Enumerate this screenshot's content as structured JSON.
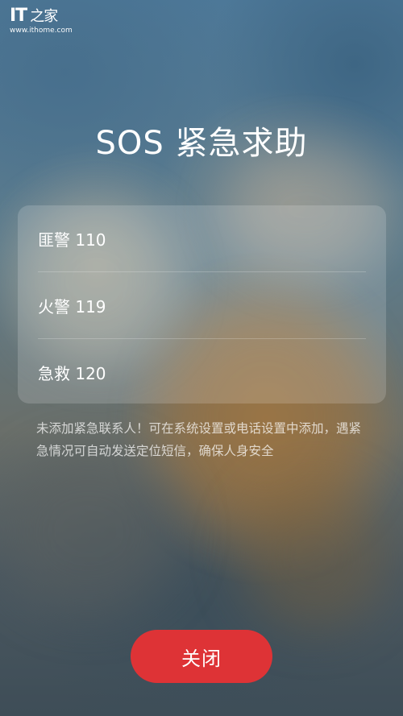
{
  "watermark": {
    "logo_latin": "IT",
    "logo_cjk": "之家",
    "url": "www.ithome.com"
  },
  "title": "SOS 紧急求助",
  "emergency_numbers": [
    {
      "label": "匪警 110"
    },
    {
      "label": "火警 119"
    },
    {
      "label": "急救 120"
    }
  ],
  "notice": "未添加紧急联系人！可在系统设置或电话设置中添加，遇紧急情况可自动发送定位短信，确保人身安全",
  "close_button": {
    "label": "关闭",
    "color": "#de3336"
  }
}
